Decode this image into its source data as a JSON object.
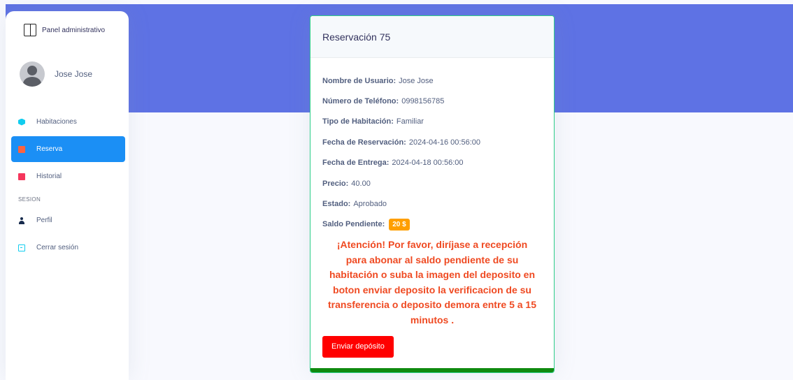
{
  "sidebar": {
    "brand": "Panel administrativo",
    "user_name": "Jose Jose",
    "items": [
      {
        "label": "Habitaciones"
      },
      {
        "label": "Reserva"
      },
      {
        "label": "Historial"
      }
    ],
    "section_heading": "SESION",
    "section_items": [
      {
        "label": "Perfil"
      },
      {
        "label": "Cerrar sesión"
      }
    ]
  },
  "card": {
    "title": "Reservación 75",
    "fields": [
      {
        "label": "Nombre de Usuario:",
        "value": "Jose Jose"
      },
      {
        "label": "Número de Teléfono:",
        "value": "0998156785"
      },
      {
        "label": "Tipo de Habitación:",
        "value": "Familiar"
      },
      {
        "label": "Fecha de Reservación:",
        "value": "2024-04-16 00:56:00"
      },
      {
        "label": "Fecha de Entrega:",
        "value": "2024-04-18 00:56:00"
      },
      {
        "label": "Precio:",
        "value": "40.00"
      },
      {
        "label": "Estado:",
        "value": "Aprobado"
      }
    ],
    "saldo_label": "Saldo Pendiente:",
    "saldo_badge": "20 $",
    "alert": "¡Atención! Por favor, diríjase a recepción para abonar al saldo pendiente de su habitación o suba la imagen del deposito en boton enviar deposito la verificacion de su transferencia o deposito demora entre 5 a 15 minutos .",
    "button": "Enviar depósito"
  },
  "colors": {
    "header_band": "#5e72e4",
    "active_nav": "#1b8ff5",
    "alert_text": "#ef4a22",
    "badge": "#ff9f00",
    "button": "#ff0000",
    "card_border": "#2dce89"
  }
}
